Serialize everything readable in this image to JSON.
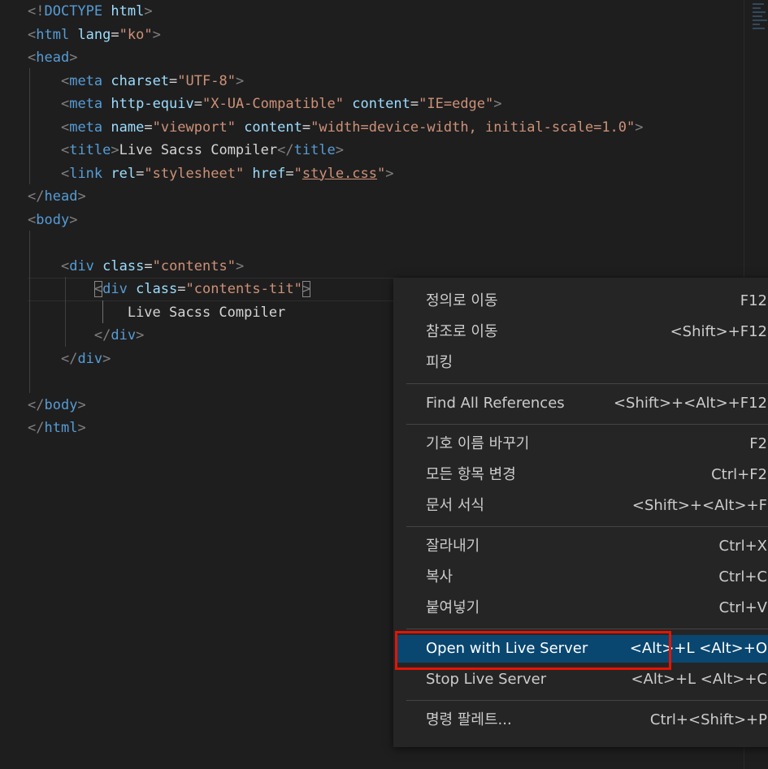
{
  "editor": {
    "lines": [
      {
        "tokens": [
          {
            "t": "<!",
            "c": "#808080"
          },
          {
            "t": "DOCTYPE",
            "c": "#569cd6"
          },
          {
            "t": " html",
            "c": "#9cdcfe"
          },
          {
            "t": ">",
            "c": "#808080"
          }
        ]
      },
      {
        "tokens": [
          {
            "t": "<",
            "c": "#808080"
          },
          {
            "t": "html",
            "c": "#569cd6"
          },
          {
            "t": " lang",
            "c": "#9cdcfe"
          },
          {
            "t": "=",
            "c": "#d4d4d4"
          },
          {
            "t": "\"ko\"",
            "c": "#ce9178"
          },
          {
            "t": ">",
            "c": "#808080"
          }
        ]
      },
      {
        "tokens": [
          {
            "t": "<",
            "c": "#808080"
          },
          {
            "t": "head",
            "c": "#569cd6"
          },
          {
            "t": ">",
            "c": "#808080"
          }
        ]
      },
      {
        "tokens": [
          {
            "t": "    ",
            "c": "#d4d4d4"
          },
          {
            "t": "<",
            "c": "#808080"
          },
          {
            "t": "meta",
            "c": "#569cd6"
          },
          {
            "t": " charset",
            "c": "#9cdcfe"
          },
          {
            "t": "=",
            "c": "#d4d4d4"
          },
          {
            "t": "\"UTF-8\"",
            "c": "#ce9178"
          },
          {
            "t": ">",
            "c": "#808080"
          }
        ]
      },
      {
        "tokens": [
          {
            "t": "    ",
            "c": "#d4d4d4"
          },
          {
            "t": "<",
            "c": "#808080"
          },
          {
            "t": "meta",
            "c": "#569cd6"
          },
          {
            "t": " http-equiv",
            "c": "#9cdcfe"
          },
          {
            "t": "=",
            "c": "#d4d4d4"
          },
          {
            "t": "\"X-UA-Compatible\"",
            "c": "#ce9178"
          },
          {
            "t": " content",
            "c": "#9cdcfe"
          },
          {
            "t": "=",
            "c": "#d4d4d4"
          },
          {
            "t": "\"IE=edge\"",
            "c": "#ce9178"
          },
          {
            "t": ">",
            "c": "#808080"
          }
        ]
      },
      {
        "tokens": [
          {
            "t": "    ",
            "c": "#d4d4d4"
          },
          {
            "t": "<",
            "c": "#808080"
          },
          {
            "t": "meta",
            "c": "#569cd6"
          },
          {
            "t": " name",
            "c": "#9cdcfe"
          },
          {
            "t": "=",
            "c": "#d4d4d4"
          },
          {
            "t": "\"viewport\"",
            "c": "#ce9178"
          },
          {
            "t": " content",
            "c": "#9cdcfe"
          },
          {
            "t": "=",
            "c": "#d4d4d4"
          },
          {
            "t": "\"width=device-width, initial-scale=1.0\"",
            "c": "#ce9178"
          },
          {
            "t": ">",
            "c": "#808080"
          }
        ]
      },
      {
        "tokens": [
          {
            "t": "    ",
            "c": "#d4d4d4"
          },
          {
            "t": "<",
            "c": "#808080"
          },
          {
            "t": "title",
            "c": "#569cd6"
          },
          {
            "t": ">",
            "c": "#808080"
          },
          {
            "t": "Live Sacss Compiler",
            "c": "#d4d4d4"
          },
          {
            "t": "</",
            "c": "#808080"
          },
          {
            "t": "title",
            "c": "#569cd6"
          },
          {
            "t": ">",
            "c": "#808080"
          }
        ]
      },
      {
        "tokens": [
          {
            "t": "    ",
            "c": "#d4d4d4"
          },
          {
            "t": "<",
            "c": "#808080"
          },
          {
            "t": "link",
            "c": "#569cd6"
          },
          {
            "t": " rel",
            "c": "#9cdcfe"
          },
          {
            "t": "=",
            "c": "#d4d4d4"
          },
          {
            "t": "\"stylesheet\"",
            "c": "#ce9178"
          },
          {
            "t": " href",
            "c": "#9cdcfe"
          },
          {
            "t": "=",
            "c": "#d4d4d4"
          },
          {
            "t": "\"",
            "c": "#ce9178"
          },
          {
            "t": "style.css",
            "c": "#ce9178",
            "u": true
          },
          {
            "t": "\"",
            "c": "#ce9178"
          },
          {
            "t": ">",
            "c": "#808080"
          }
        ]
      },
      {
        "tokens": [
          {
            "t": "</",
            "c": "#808080"
          },
          {
            "t": "head",
            "c": "#569cd6"
          },
          {
            "t": ">",
            "c": "#808080"
          }
        ]
      },
      {
        "tokens": [
          {
            "t": "<",
            "c": "#808080"
          },
          {
            "t": "body",
            "c": "#569cd6"
          },
          {
            "t": ">",
            "c": "#808080"
          }
        ]
      },
      {
        "tokens": []
      },
      {
        "tokens": [
          {
            "t": "    ",
            "c": "#d4d4d4"
          },
          {
            "t": "<",
            "c": "#808080"
          },
          {
            "t": "div",
            "c": "#569cd6"
          },
          {
            "t": " class",
            "c": "#9cdcfe"
          },
          {
            "t": "=",
            "c": "#d4d4d4"
          },
          {
            "t": "\"contents\"",
            "c": "#ce9178"
          },
          {
            "t": ">",
            "c": "#808080"
          }
        ]
      },
      {
        "tokens": [
          {
            "t": "        ",
            "c": "#d4d4d4"
          },
          {
            "t": "<",
            "c": "#808080",
            "b": true
          },
          {
            "t": "div",
            "c": "#569cd6"
          },
          {
            "t": " class",
            "c": "#9cdcfe"
          },
          {
            "t": "=",
            "c": "#d4d4d4"
          },
          {
            "t": "\"contents-tit\"",
            "c": "#ce9178"
          },
          {
            "t": ">",
            "c": "#808080",
            "b": true
          }
        ]
      },
      {
        "tokens": [
          {
            "t": "            ",
            "c": "#d4d4d4"
          },
          {
            "t": "Live Sacss Compiler",
            "c": "#d4d4d4"
          }
        ]
      },
      {
        "tokens": [
          {
            "t": "        ",
            "c": "#d4d4d4"
          },
          {
            "t": "</",
            "c": "#808080"
          },
          {
            "t": "div",
            "c": "#569cd6"
          },
          {
            "t": ">",
            "c": "#808080"
          }
        ]
      },
      {
        "tokens": [
          {
            "t": "    ",
            "c": "#d4d4d4"
          },
          {
            "t": "</",
            "c": "#808080"
          },
          {
            "t": "div",
            "c": "#569cd6"
          },
          {
            "t": ">",
            "c": "#808080"
          }
        ]
      },
      {
        "tokens": []
      },
      {
        "tokens": [
          {
            "t": "</",
            "c": "#808080"
          },
          {
            "t": "body",
            "c": "#569cd6"
          },
          {
            "t": ">",
            "c": "#808080"
          }
        ]
      },
      {
        "tokens": [
          {
            "t": "</",
            "c": "#808080"
          },
          {
            "t": "html",
            "c": "#569cd6"
          },
          {
            "t": ">",
            "c": "#808080"
          }
        ]
      }
    ]
  },
  "context_menu": {
    "groups": [
      [
        {
          "label": "정의로 이동",
          "shortcut": "F12",
          "name": "go-to-definition"
        },
        {
          "label": "참조로 이동",
          "shortcut": "<Shift>+F12",
          "name": "go-to-references"
        },
        {
          "label": "피킹",
          "shortcut": "",
          "name": "peek"
        }
      ],
      [
        {
          "label": "Find All References",
          "shortcut": "<Shift>+<Alt>+F12",
          "name": "find-all-references"
        }
      ],
      [
        {
          "label": "기호 이름 바꾸기",
          "shortcut": "F2",
          "name": "rename-symbol"
        },
        {
          "label": "모든 항목 변경",
          "shortcut": "Ctrl+F2",
          "name": "change-all-occurrences"
        },
        {
          "label": "문서 서식",
          "shortcut": "<Shift>+<Alt>+F",
          "name": "format-document"
        }
      ],
      [
        {
          "label": "잘라내기",
          "shortcut": "Ctrl+X",
          "name": "cut"
        },
        {
          "label": "복사",
          "shortcut": "Ctrl+C",
          "name": "copy"
        },
        {
          "label": "붙여넣기",
          "shortcut": "Ctrl+V",
          "name": "paste"
        }
      ],
      [
        {
          "label": "Open with Live Server",
          "shortcut": "<Alt>+L <Alt>+O",
          "name": "open-with-live-server",
          "highlighted": true
        },
        {
          "label": "Stop Live Server",
          "shortcut": "<Alt>+L <Alt>+C",
          "name": "stop-live-server"
        }
      ],
      [
        {
          "label": "명령 팔레트...",
          "shortcut": "Ctrl+<Shift>+P",
          "name": "command-palette"
        }
      ]
    ]
  },
  "colors": {
    "background": "#1e1e1e",
    "menu_background": "#252526",
    "highlight": "#094771",
    "annotation": "#e51400"
  }
}
